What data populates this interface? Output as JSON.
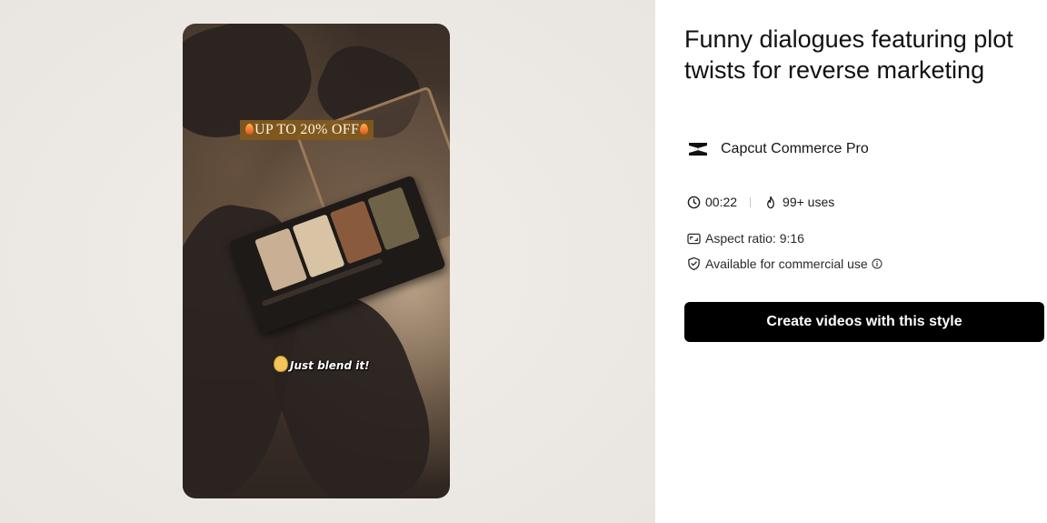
{
  "preview": {
    "promo_text": "UP TO 20% OFF",
    "caption_text": "Just blend it!",
    "icons": [
      "fire-icon",
      "face-emoji-icon"
    ],
    "shade_colors": [
      "#c9b095",
      "#d8c3a4",
      "#8a5a3c",
      "#6e6248",
      "#8d8f6e"
    ]
  },
  "template": {
    "title": "Funny dialogues featuring plot twists for reverse marketing",
    "author": "Capcut Commerce Pro",
    "duration": "00:22",
    "uses": "99+ uses",
    "aspect_ratio": "Aspect ratio: 9:16",
    "commercial": "Available for commercial use"
  },
  "cta": {
    "label": "Create videos with this style"
  },
  "colors": {
    "button_bg": "#000000",
    "button_text": "#ffffff",
    "preview_bg": "#ece8e3",
    "promo_bg": "#825a1e"
  }
}
